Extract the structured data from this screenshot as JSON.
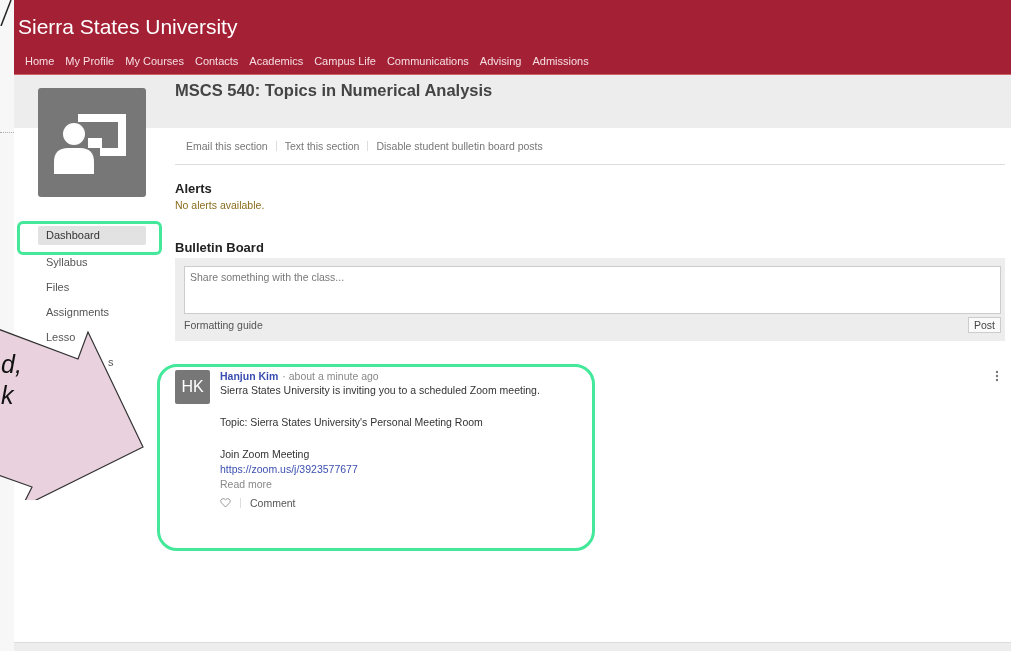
{
  "site_title": "Sierra States University",
  "nav": [
    "Home",
    "My Profile",
    "My Courses",
    "Contacts",
    "Academics",
    "Campus Life",
    "Communications",
    "Advising",
    "Admissions"
  ],
  "course": {
    "title": "MSCS 540: Topics in Numerical Analysis",
    "actions": [
      "Email this section",
      "Text this section",
      "Disable student bulletin board posts"
    ]
  },
  "sidebar": {
    "items": [
      {
        "label": "Dashboard",
        "selected": true
      },
      {
        "label": "Syllabus",
        "selected": false
      },
      {
        "label": "Files",
        "selected": false
      },
      {
        "label": "Assignments",
        "selected": false
      },
      {
        "label": "Lesso",
        "selected": false
      },
      {
        "label": "s",
        "selected": false
      }
    ]
  },
  "alerts": {
    "heading": "Alerts",
    "message": "No alerts available."
  },
  "bulletin_board": {
    "heading": "Bulletin Board",
    "placeholder": "Share something with the class...",
    "formatting_link": "Formatting guide",
    "post_button": "Post"
  },
  "posts": [
    {
      "initials": "HK",
      "author": "Hanjun Kim",
      "separator": "·",
      "time": "about a minute ago",
      "message": "Sierra States University is inviting you to a scheduled Zoom meeting.",
      "topic": "Topic: Sierra States University's Personal Meeting Room",
      "join_label": "Join Zoom Meeting",
      "link": "https://zoom.us/j/3923577677",
      "read_more": "Read more",
      "comment": "Comment"
    }
  ],
  "callout": {
    "texts": [
      "d,",
      "k"
    ]
  }
}
